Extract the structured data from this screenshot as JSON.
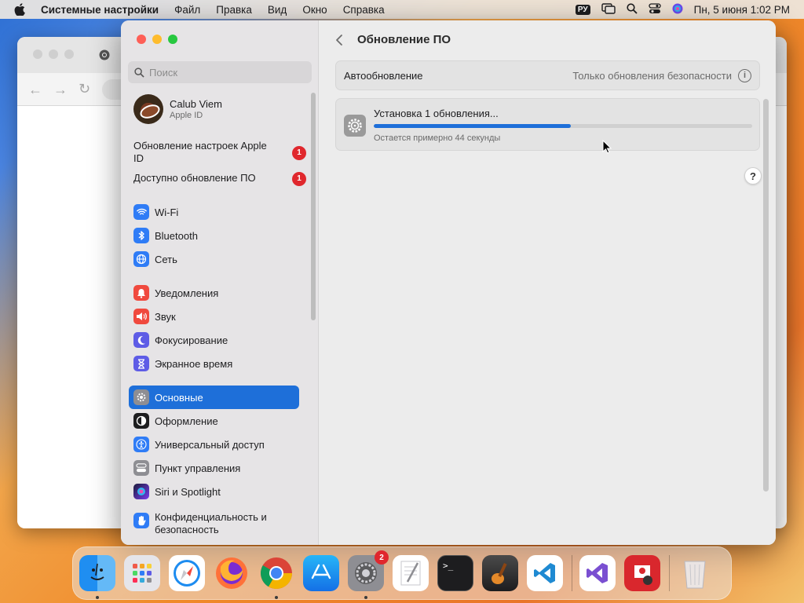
{
  "menubar": {
    "app_name": "Системные настройки",
    "menus": [
      "Файл",
      "Правка",
      "Вид",
      "Окно",
      "Справка"
    ],
    "input_lang": "РУ",
    "datetime": "Пн, 5 июня  1:02 PM"
  },
  "sidebar": {
    "search_placeholder": "Поиск",
    "profile": {
      "name": "Calub Viem",
      "sub": "Apple ID"
    },
    "notifications": [
      {
        "label": "Обновление настроек Apple ID",
        "count": "1"
      },
      {
        "label": "Доступно обновление ПО",
        "count": "1"
      }
    ],
    "items": [
      {
        "label": "Wi-Fi",
        "icon": "wifi-icon",
        "color": "#2f7cf6"
      },
      {
        "label": "Bluetooth",
        "icon": "bluetooth-icon",
        "color": "#2f7cf6"
      },
      {
        "label": "Сеть",
        "icon": "globe-icon",
        "color": "#2f7cf6"
      },
      {
        "label": "Уведомления",
        "icon": "bell-icon",
        "color": "#f0493e"
      },
      {
        "label": "Звук",
        "icon": "speaker-icon",
        "color": "#f0493e"
      },
      {
        "label": "Фокусирование",
        "icon": "moon-icon",
        "color": "#5e5ce6"
      },
      {
        "label": "Экранное время",
        "icon": "hourglass-icon",
        "color": "#5e5ce6"
      },
      {
        "label": "Основные",
        "icon": "gear-icon",
        "color": "#8e8e93"
      },
      {
        "label": "Оформление",
        "icon": "appearance-icon",
        "color": "#1d1d1f"
      },
      {
        "label": "Универсальный доступ",
        "icon": "accessibility-icon",
        "color": "#2f7cf6"
      },
      {
        "label": "Пункт управления",
        "icon": "control-center-icon",
        "color": "#8e8e93"
      },
      {
        "label": "Siri и Spotlight",
        "icon": "siri-icon",
        "color": "#7a3df0"
      },
      {
        "label": "Конфиденциальность и безопасность",
        "icon": "hand-icon",
        "color": "#2f7cf6"
      }
    ]
  },
  "main": {
    "title": "Обновление ПО",
    "auto_update": {
      "label": "Автообновление",
      "value": "Только обновления безопасности"
    },
    "install": {
      "title": "Установка 1 обновления...",
      "progress": 0.52,
      "subtitle": "Остается примерно 44 секунды"
    },
    "help_label": "?"
  },
  "dock": {
    "apps": [
      "Finder",
      "Launchpad",
      "Safari",
      "Firefox",
      "Google Chrome",
      "App Store",
      "Системные настройки",
      "TextEdit",
      "Terminal",
      "GarageBand",
      "Visual Studio Code",
      "Visual Studio",
      "Photo Booth",
      "Корзина"
    ],
    "settings_badge": "2"
  }
}
